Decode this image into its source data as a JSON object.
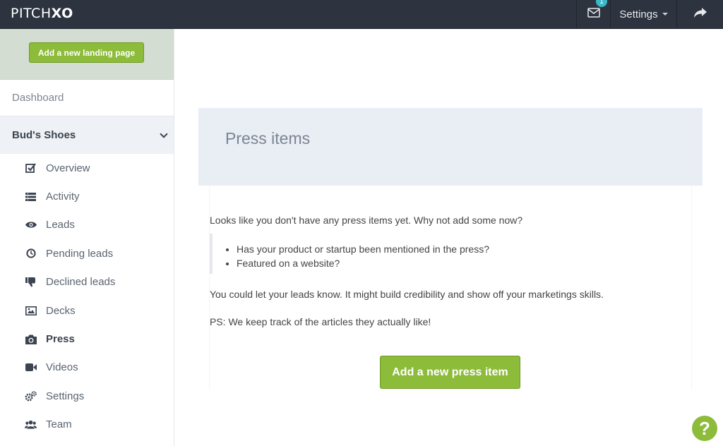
{
  "topbar": {
    "logo_regular": "PITCH",
    "logo_bold": "XO",
    "notification_count": "1",
    "settings_label": "Settings"
  },
  "sidebar": {
    "add_landing_label": "Add a new landing page",
    "dashboard_label": "Dashboard",
    "project_name": "Bud's Shoes",
    "items": [
      {
        "label": "Overview",
        "icon": "checkbox-icon"
      },
      {
        "label": "Activity",
        "icon": "list-icon"
      },
      {
        "label": "Leads",
        "icon": "eye-icon"
      },
      {
        "label": "Pending leads",
        "icon": "clock-icon"
      },
      {
        "label": "Declined leads",
        "icon": "thumbs-down-icon"
      },
      {
        "label": "Decks",
        "icon": "image-icon"
      },
      {
        "label": "Press",
        "icon": "camera-icon"
      },
      {
        "label": "Videos",
        "icon": "video-camera-icon"
      },
      {
        "label": "Settings",
        "icon": "gears-icon"
      },
      {
        "label": "Team",
        "icon": "users-icon"
      }
    ],
    "active_item": "Press"
  },
  "main": {
    "title": "Press items",
    "intro": "Looks like you don't have any press items yet. Why not add some now?",
    "bullets": [
      "Has your product or startup been mentioned in the press?",
      "Featured on a website?"
    ],
    "line2": "You could let your leads know. It might build credibility and show off your marketings skills.",
    "line3": "PS: We keep track of the articles they actually like!",
    "add_button_label": "Add a new press item"
  },
  "help_label": "?",
  "colors": {
    "topbar": "#2d333f",
    "accent_green": "#8dbb3a",
    "badge": "#3ab8c8",
    "panel_head": "#e9edf4"
  }
}
